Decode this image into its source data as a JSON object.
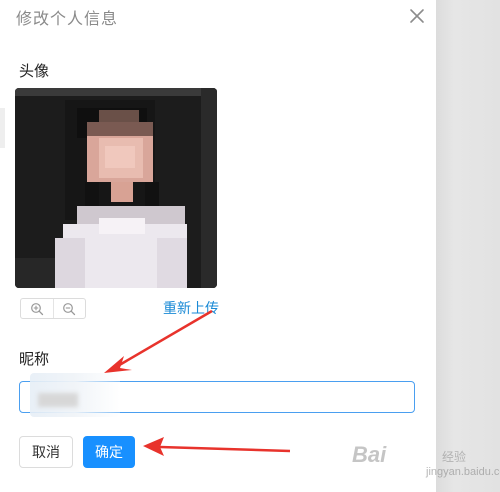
{
  "dialog": {
    "title": "修改个人信息",
    "close_icon": "close-icon"
  },
  "avatar_section": {
    "label": "头像",
    "zoom_in_icon": "zoom-in-icon",
    "zoom_out_icon": "zoom-out-icon",
    "reupload_label": "重新上传"
  },
  "nickname_section": {
    "label": "昵称",
    "value": ""
  },
  "footer": {
    "cancel_label": "取消",
    "confirm_label": "确定"
  },
  "annotations": {
    "arrow_color": "#e8332c"
  },
  "watermark": {
    "brand": "Bai",
    "sub": "经验",
    "url": "jingyan.baidu.com"
  },
  "colors": {
    "primary": "#1890ff",
    "link": "#1a8ad6",
    "input_border_focus": "#4a9ff0"
  }
}
